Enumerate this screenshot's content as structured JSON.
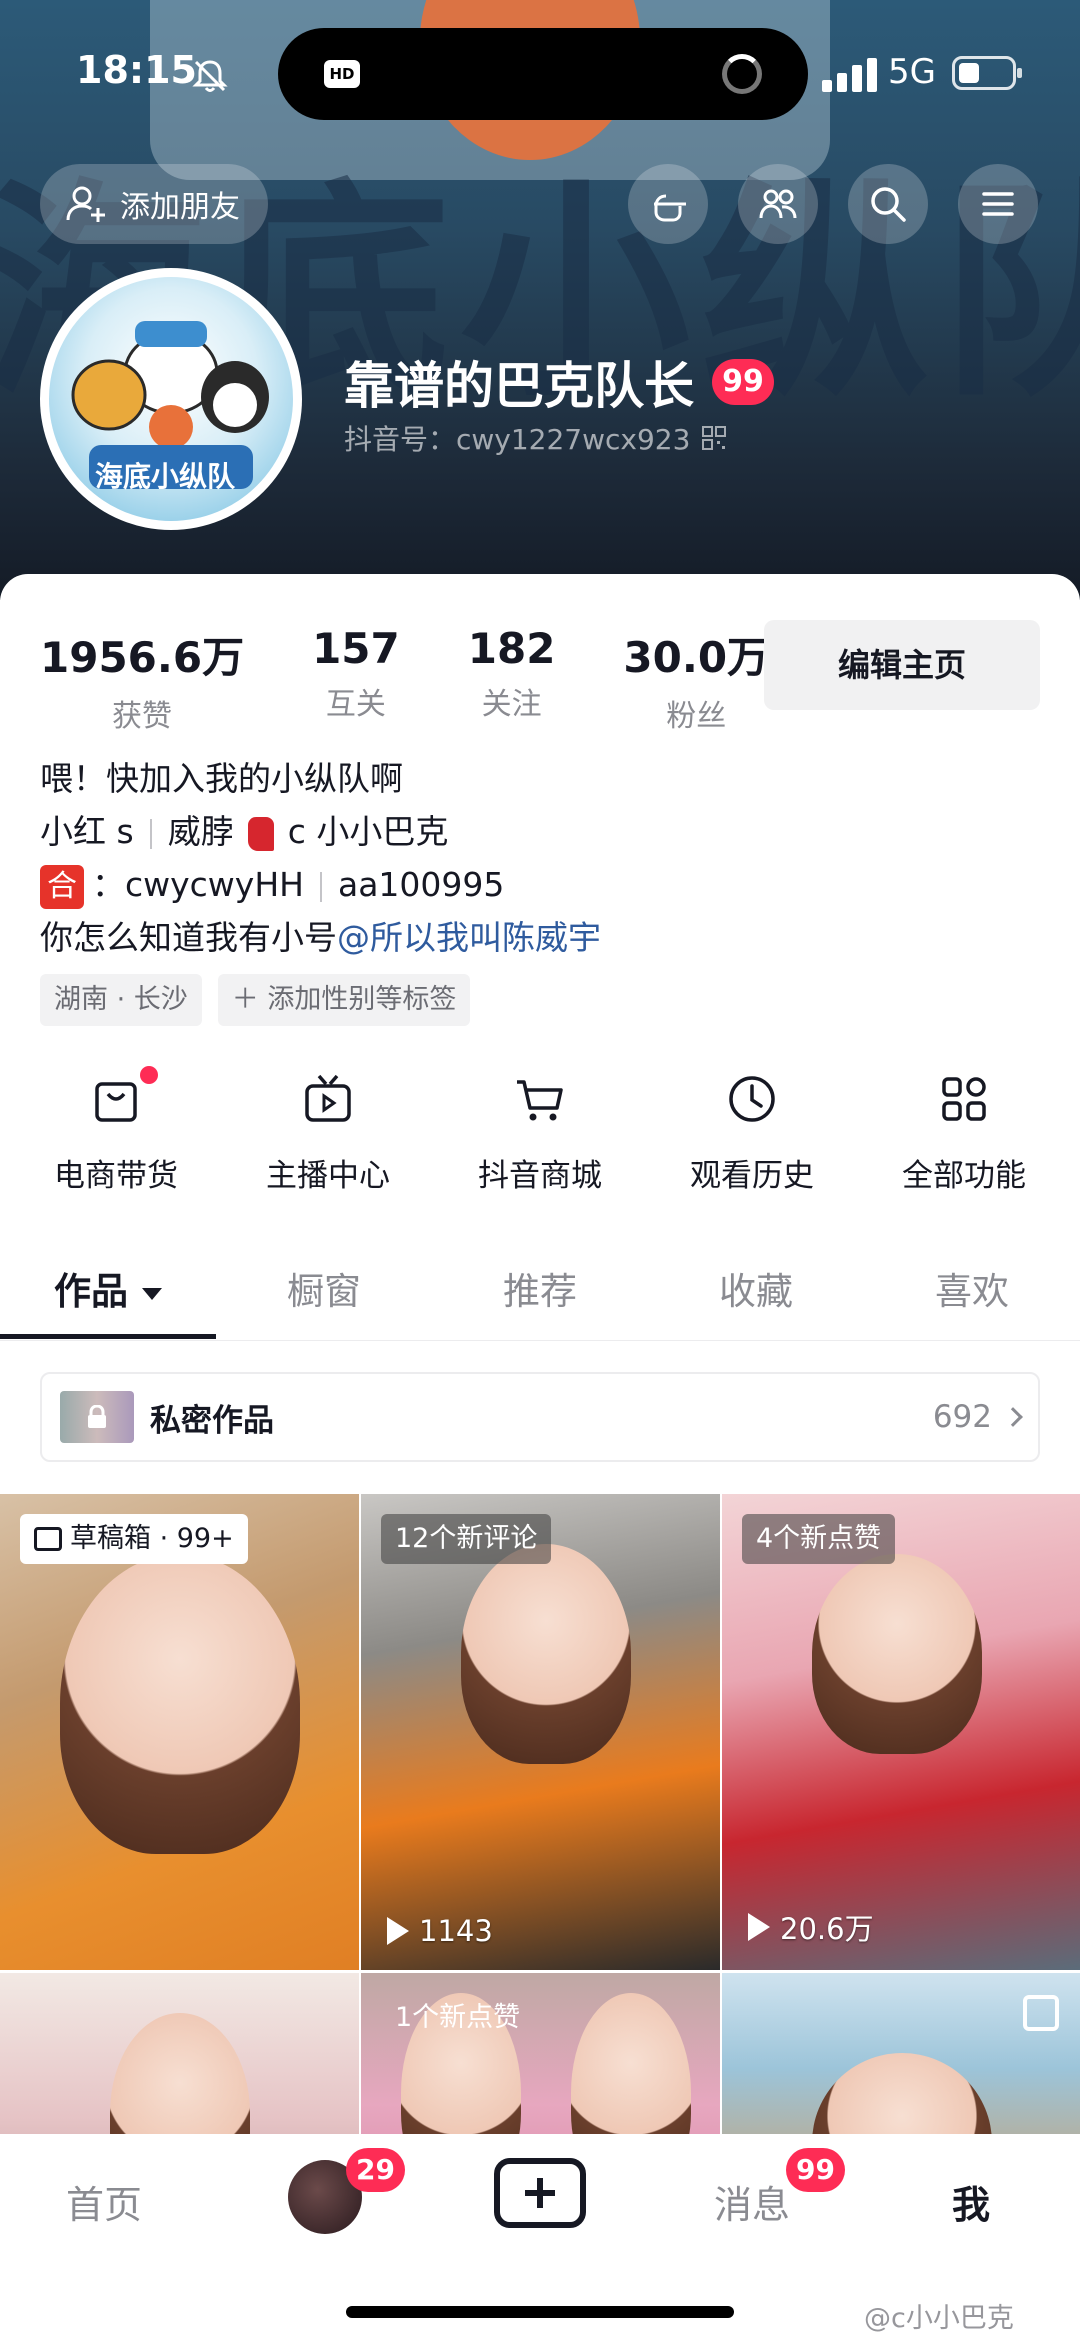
{
  "status_bar": {
    "time": "18:15",
    "network": "5G",
    "island_badge": "HD",
    "icons": [
      "bell-muted-icon",
      "signal-icon",
      "battery-icon"
    ]
  },
  "header": {
    "banner_text": "海底小纵队",
    "add_friend_label": "添加朋友",
    "icons": [
      "hand-pointer-icon",
      "people-icon",
      "search-icon",
      "menu-icon"
    ]
  },
  "profile": {
    "avatar_text": "海底小纵队",
    "nickname": "靠谱的巴克队长",
    "level": "99",
    "douyin_id": "抖音号：cwy1227wcx923"
  },
  "stats": [
    {
      "value": "1956.6万",
      "label": "获赞"
    },
    {
      "value": "157",
      "label": "互关"
    },
    {
      "value": "182",
      "label": "关注"
    },
    {
      "value": "30.0万",
      "label": "粉丝"
    }
  ],
  "edit_button": "编辑主页",
  "bio": {
    "line1": "喂！快加入我的小纵队啊",
    "line2_a": "小红 s",
    "line2_b": "威脖",
    "line2_c": "c 小小巴克",
    "line3_icon": "合",
    "line3_a": "：cwycwyHH",
    "line3_b": "aa100995",
    "line4_text": "你怎么知道我有小号",
    "line4_mention": "@所以我叫陈威宇"
  },
  "tags": [
    "湖南 · 长沙",
    "＋ 添加性别等标签"
  ],
  "features": [
    {
      "label": "电商带货",
      "icon": "shopping-bag-icon"
    },
    {
      "label": "主播中心",
      "icon": "tv-icon"
    },
    {
      "label": "抖音商城",
      "icon": "cart-icon"
    },
    {
      "label": "观看历史",
      "icon": "clock-icon"
    },
    {
      "label": "全部功能",
      "icon": "grid-icon"
    }
  ],
  "tabs": [
    "作品",
    "橱窗",
    "推荐",
    "收藏",
    "喜欢"
  ],
  "private_row": {
    "label": "私密作品",
    "count": "692"
  },
  "grid": [
    {
      "badge": "草稿箱 · 99+",
      "plays": ""
    },
    {
      "badge": "12个新评论",
      "plays": "1143"
    },
    {
      "badge": "4个新点赞",
      "plays": "20.6万"
    },
    {
      "badge": "",
      "plays": ""
    },
    {
      "badge": "1个新点赞",
      "plays": ""
    },
    {
      "badge": "",
      "plays": ""
    }
  ],
  "bottom_nav": {
    "home": "首页",
    "friends_badge": "29",
    "messages": "消息",
    "messages_badge": "99",
    "me": "我"
  },
  "watermark": "@c小小巴克",
  "colors": {
    "accent": "#fe2c55",
    "mention": "#2f5b9e",
    "text": "#161823",
    "muted": "#8a8b91"
  }
}
